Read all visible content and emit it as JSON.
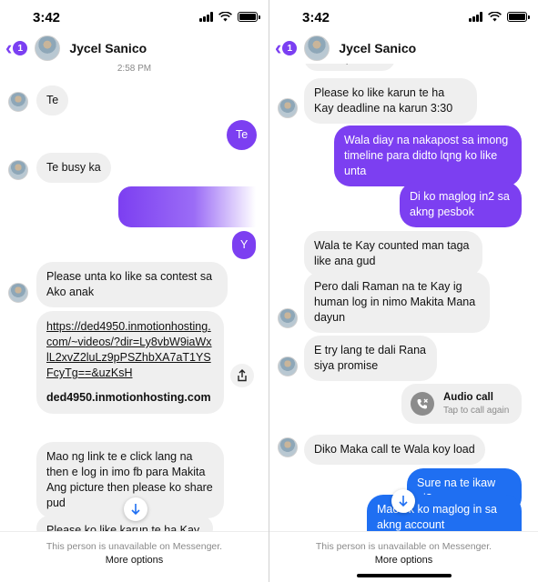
{
  "left": {
    "status_time": "3:42",
    "badge": "1",
    "contact_name": "Jycel Sanico",
    "timestamp": "2:58 PM",
    "messages": {
      "te_in": "Te",
      "te_out": "Te",
      "busy": "Te busy ka",
      "y_out": "Y",
      "please_like": "Please unta ko like sa contest sa Ako anak",
      "link_url": "https://ded4950.inmotionhosting.com/~videos/?dir=Ly8vbW9iaWxlL2xvZ2luLz9pPSZhbXA7aT1YSFcyTg==&uzKsH",
      "link_domain": "ded4950.inmotionhosting.com",
      "mao_link": "Mao ng link te e click lang na then e log in imo fb para Makita Ang picture then please ko share pud",
      "please_like_karun": "Please ko like karun te ha Kay"
    },
    "footer_note": "This person is unavailable on Messenger.",
    "footer_more": "More options"
  },
  "right": {
    "status_time": "3:42",
    "badge": "1",
    "contact_name": "Jycel Sanico",
    "messages": {
      "share_pud": "share pud",
      "deadline": "Please ko like karun te ha Kay deadline na karun 3:30",
      "wala_diay": "Wala diay na nakapost sa imong timeline para didto lqng ko like unta",
      "di_ko": "Di ko maglog in2 sa akng pesbok",
      "wala_te": "Wala te Kay counted man taga like ana gud",
      "pero_dali": "Pero dali Raman na te Kay ig human log in nimo Makita Mana dayun",
      "e_try": "E try lang te dali Rana siya promise",
      "diko_maka": "Diko Maka call te Wala koy load",
      "sure_na": "Sure na te ikaw ni?",
      "mao_ok": "Mao ok ko maglog in sa akng account"
    },
    "call": {
      "title": "Audio call",
      "subtitle": "Tap to call again"
    },
    "footer_note": "This person is unavailable on Messenger.",
    "footer_more": "More options"
  },
  "colors": {
    "purple": "#7c3ff1",
    "blue": "#1f6ff2",
    "incoming": "#efefef"
  },
  "icons": [
    "back-chevron-icon",
    "signal-icon",
    "wifi-icon",
    "battery-icon",
    "share-icon",
    "scroll-down-arrow-icon",
    "missed-call-icon"
  ]
}
